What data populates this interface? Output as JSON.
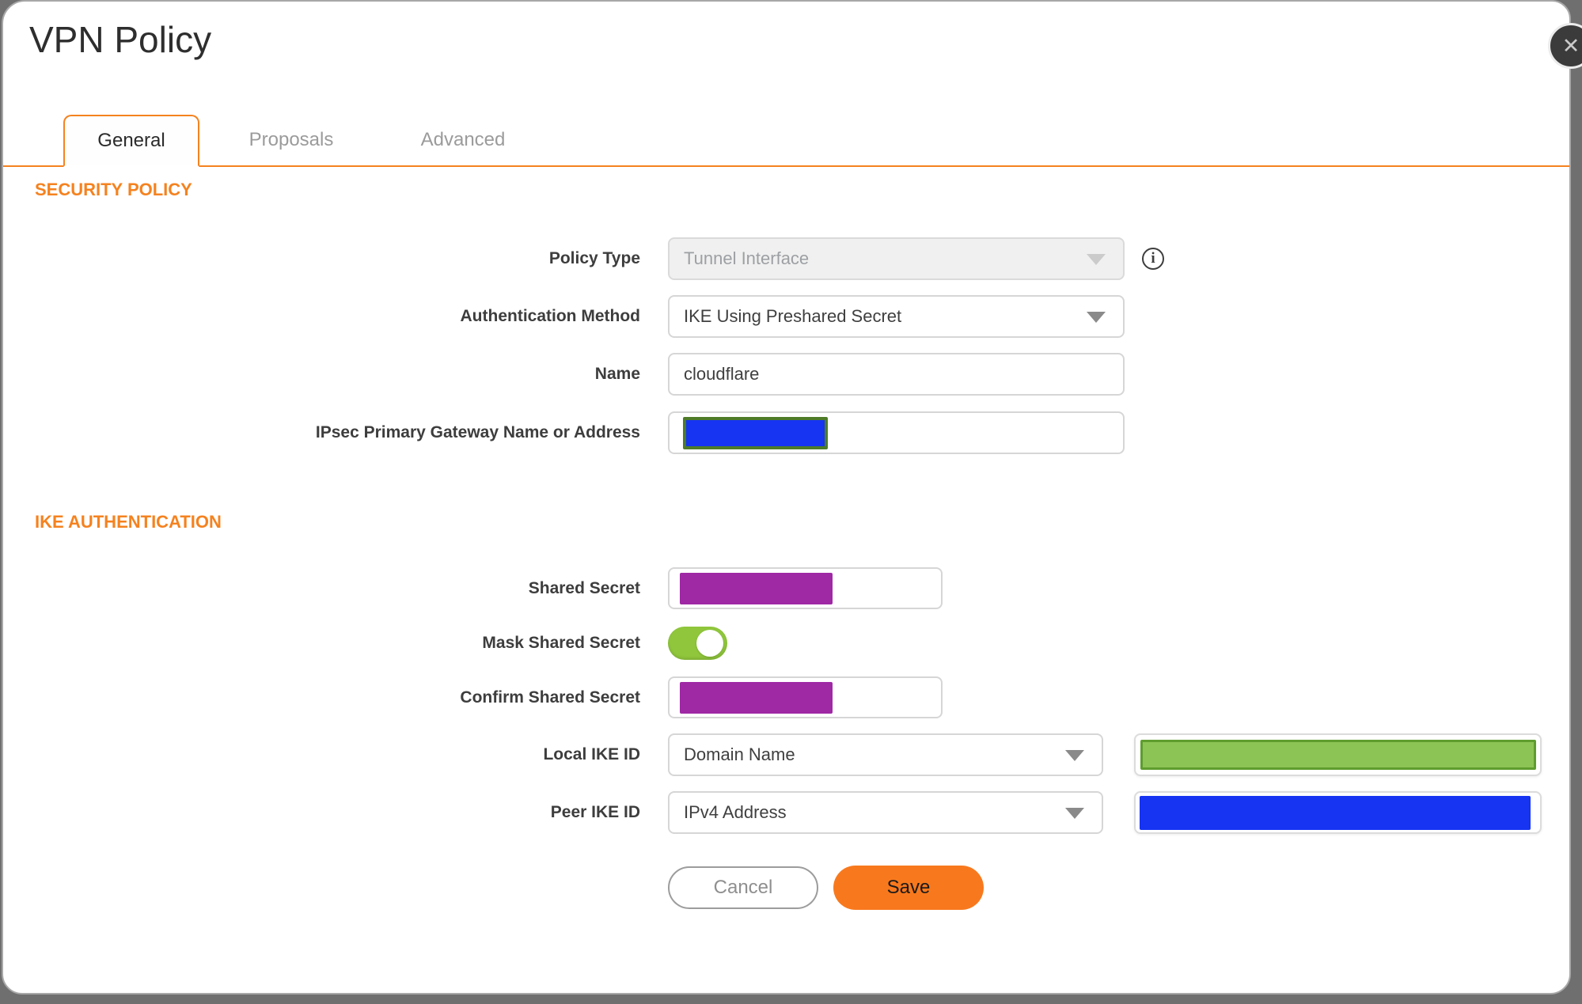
{
  "dialog": {
    "title": "VPN Policy"
  },
  "icons": {
    "close": "✕",
    "info": "i"
  },
  "tabs": [
    {
      "label": "General",
      "active": true
    },
    {
      "label": "Proposals",
      "active": false
    },
    {
      "label": "Advanced",
      "active": false
    }
  ],
  "sections": {
    "security_policy": "SECURITY POLICY",
    "ike_authentication": "IKE AUTHENTICATION"
  },
  "fields": {
    "policy_type": {
      "label": "Policy Type",
      "value": "Tunnel Interface",
      "disabled": true
    },
    "auth_method": {
      "label": "Authentication Method",
      "value": "IKE Using Preshared Secret"
    },
    "name": {
      "label": "Name",
      "value": "cloudflare"
    },
    "gateway": {
      "label": "IPsec Primary Gateway Name or Address",
      "value_redacted": true
    },
    "shared_secret": {
      "label": "Shared Secret",
      "value_redacted": true
    },
    "mask_shared_secret": {
      "label": "Mask Shared Secret",
      "enabled": true
    },
    "confirm_shared_secret": {
      "label": "Confirm Shared Secret",
      "value_redacted": true
    },
    "local_ike_id": {
      "label": "Local IKE ID",
      "value": "Domain Name",
      "id_value_redacted": true
    },
    "peer_ike_id": {
      "label": "Peer IKE ID",
      "value": "IPv4 Address",
      "id_value_redacted": true
    }
  },
  "buttons": {
    "cancel": "Cancel",
    "save": "Save"
  },
  "colors": {
    "accent_orange": "#f5821f",
    "save_orange": "#f8791d",
    "toggle_green": "#8fc63b",
    "redaction_purple": "#9f28a5",
    "redaction_blue": "#1634f2",
    "redaction_green_fill": "#8cc455",
    "redaction_green_border": "#5f9d2f",
    "redaction_olive_border": "#4e7b28",
    "backdrop_gray": "#6f6f6f"
  }
}
